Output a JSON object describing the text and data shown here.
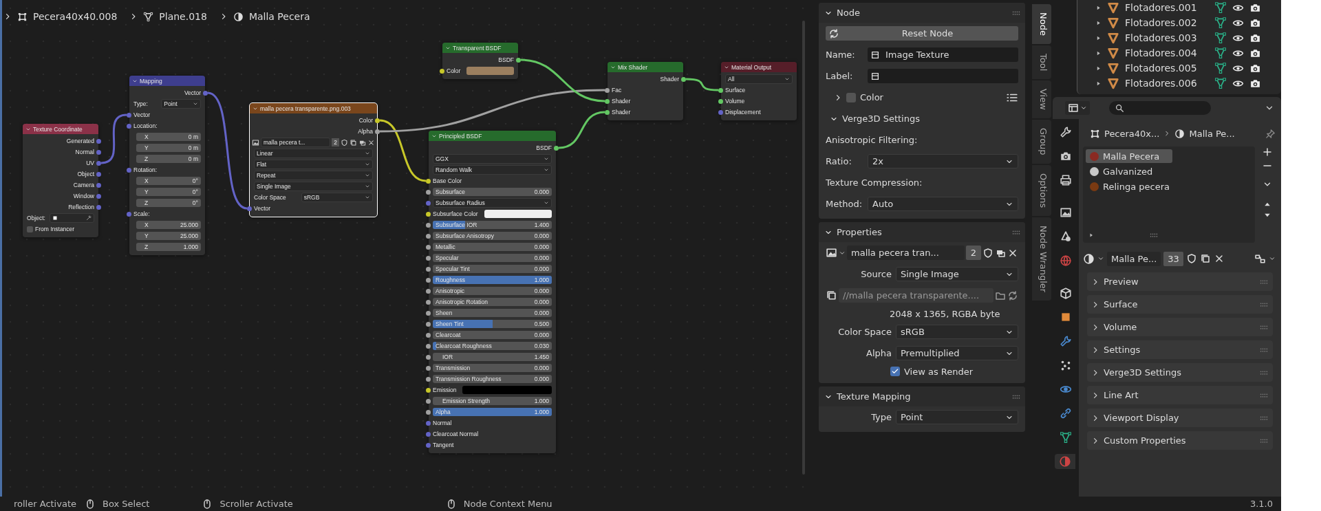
{
  "breadcrumb": [
    {
      "label": "Pecera40x40.008"
    },
    {
      "label": "Plane.018"
    },
    {
      "label": "Malla Pecera"
    }
  ],
  "nodes": [
    {
      "title": "Texture Coordinate",
      "kind": "input",
      "selected": false,
      "rows": [
        {
          "kind": "out",
          "label": "Generated",
          "color": "#6363c7"
        },
        {
          "kind": "out",
          "label": "Normal",
          "color": "#6363c7"
        },
        {
          "kind": "out",
          "label": "UV",
          "color": "#6363c7"
        },
        {
          "kind": "out",
          "label": "Object",
          "color": "#6363c7"
        },
        {
          "kind": "out",
          "label": "Camera",
          "color": "#6363c7"
        },
        {
          "kind": "out",
          "label": "Window",
          "color": "#6363c7"
        },
        {
          "kind": "out",
          "label": "Reflection",
          "color": "#6363c7"
        },
        {
          "kind": "object",
          "label": "Object:"
        },
        {
          "kind": "check",
          "label": "From Instancer",
          "checked": false
        }
      ]
    },
    {
      "title": "Mapping",
      "kind": "vector",
      "selected": false,
      "rows": [
        {
          "kind": "out",
          "label": "Vector",
          "color": "#6363c7"
        },
        {
          "kind": "dropdown",
          "label": "Type:",
          "value": "Point"
        },
        {
          "kind": "in",
          "label": "Vector",
          "color": "#6363c7"
        },
        {
          "kind": "heading",
          "label": "Location:",
          "color": "#6363c7"
        },
        {
          "kind": "axis",
          "label": "X",
          "value": "0 m"
        },
        {
          "kind": "axis",
          "label": "Y",
          "value": "0 m"
        },
        {
          "kind": "axis",
          "label": "Z",
          "value": "0 m"
        },
        {
          "kind": "heading",
          "label": "Rotation:",
          "color": "#6363c7"
        },
        {
          "kind": "axis",
          "label": "X",
          "value": "0°"
        },
        {
          "kind": "axis",
          "label": "Y",
          "value": "0°"
        },
        {
          "kind": "axis",
          "label": "Z",
          "value": "0°"
        },
        {
          "kind": "heading",
          "label": "Scale:",
          "color": "#6363c7"
        },
        {
          "kind": "axis",
          "label": "X",
          "value": "25.000"
        },
        {
          "kind": "axis",
          "label": "Y",
          "value": "25.000"
        },
        {
          "kind": "axis",
          "label": "Z",
          "value": "1.000"
        }
      ]
    },
    {
      "title": "malla pecera transparente.png.003",
      "kind": "texture",
      "selected": true,
      "rows": [
        {
          "kind": "out",
          "label": "Color",
          "color": "#c7c729"
        },
        {
          "kind": "out",
          "label": "Alpha",
          "color": "#a1a1a1"
        },
        {
          "kind": "image",
          "name": "malla pecera t...",
          "users": "2"
        },
        {
          "kind": "dropdown",
          "value": "Linear"
        },
        {
          "kind": "dropdown",
          "value": "Flat"
        },
        {
          "kind": "dropdown",
          "value": "Repeat"
        },
        {
          "kind": "dropdown",
          "value": "Single Image"
        },
        {
          "kind": "dropdown",
          "label": "Color Space",
          "value": "sRGB"
        },
        {
          "kind": "in",
          "label": "Vector",
          "color": "#6363c7"
        }
      ]
    },
    {
      "title": "Transparent BSDF",
      "kind": "shader",
      "selected": false,
      "rows": [
        {
          "kind": "out",
          "label": "BSDF",
          "color": "#63c763"
        },
        {
          "kind": "color",
          "label": "Color",
          "color": "#c7c729",
          "swatch": {
            "color": "#9b7f5f"
          }
        }
      ]
    },
    {
      "title": "Principled BSDF",
      "kind": "shader",
      "selected": false,
      "rows": [
        {
          "kind": "out",
          "label": "BSDF",
          "color": "#63c763"
        },
        {
          "kind": "dropdown",
          "value": "GGX"
        },
        {
          "kind": "dropdown",
          "value": "Random Walk"
        },
        {
          "kind": "in",
          "label": "Base Color",
          "color": "#c7c729"
        },
        {
          "kind": "slider",
          "label": "Subsurface",
          "value": "0.000",
          "level": 0,
          "color": "#a1a1a1"
        },
        {
          "kind": "dropdown",
          "value": "Subsurface Radius",
          "color": "#6363c7"
        },
        {
          "kind": "color",
          "label": "Subsurface Color",
          "color": "#c7c729",
          "swatch": {
            "color": "#f0f0f0"
          }
        },
        {
          "kind": "slider",
          "label": "Subsurface IOR",
          "value": "1.400",
          "level": 0.27,
          "color": "#a1a1a1"
        },
        {
          "kind": "slider",
          "label": "Subsurface Anisotropy",
          "value": "0.000",
          "level": 0,
          "color": "#a1a1a1"
        },
        {
          "kind": "slider",
          "label": "Metallic",
          "value": "0.000",
          "level": 0,
          "color": "#a1a1a1"
        },
        {
          "kind": "slider",
          "label": "Specular",
          "value": "0.000",
          "level": 0,
          "color": "#a1a1a1"
        },
        {
          "kind": "slider",
          "label": "Specular Tint",
          "value": "0.000",
          "level": 0,
          "color": "#a1a1a1"
        },
        {
          "kind": "slider",
          "label": "Roughness",
          "value": "1.000",
          "level": 1,
          "color": "#a1a1a1"
        },
        {
          "kind": "slider",
          "label": "Anisotropic",
          "value": "0.000",
          "level": 0,
          "color": "#a1a1a1"
        },
        {
          "kind": "slider",
          "label": "Anisotropic Rotation",
          "value": "0.000",
          "level": 0,
          "color": "#a1a1a1"
        },
        {
          "kind": "slider",
          "label": "Sheen",
          "value": "0.000",
          "level": 0,
          "color": "#a1a1a1"
        },
        {
          "kind": "slider",
          "label": "Sheen Tint",
          "value": "0.500",
          "level": 0.5,
          "color": "#a1a1a1"
        },
        {
          "kind": "slider",
          "label": "Clearcoat",
          "value": "0.000",
          "level": 0,
          "color": "#a1a1a1"
        },
        {
          "kind": "slider",
          "label": "Clearcoat Roughness",
          "value": "0.030",
          "level": 0.03,
          "color": "#a1a1a1"
        },
        {
          "kind": "number",
          "label": "IOR",
          "value": "1.450",
          "color": "#a1a1a1"
        },
        {
          "kind": "slider",
          "label": "Transmission",
          "value": "0.000",
          "level": 0,
          "color": "#a1a1a1"
        },
        {
          "kind": "slider",
          "label": "Transmission Roughness",
          "value": "0.000",
          "level": 0,
          "color": "#a1a1a1"
        },
        {
          "kind": "color",
          "label": "Emission",
          "color": "#c7c729",
          "swatch": {
            "color": "#000000"
          }
        },
        {
          "kind": "number",
          "label": "Emission Strength",
          "value": "1.000",
          "color": "#a1a1a1"
        },
        {
          "kind": "slider",
          "label": "Alpha",
          "value": "1.000",
          "level": 1,
          "color": "#a1a1a1"
        },
        {
          "kind": "in",
          "label": "Normal",
          "color": "#6363c7"
        },
        {
          "kind": "in",
          "label": "Clearcoat Normal",
          "color": "#6363c7"
        },
        {
          "kind": "in",
          "label": "Tangent",
          "color": "#6363c7"
        }
      ]
    },
    {
      "title": "Mix Shader",
      "kind": "shader",
      "selected": false,
      "rows": [
        {
          "kind": "out",
          "label": "Shader",
          "color": "#63c763"
        },
        {
          "kind": "in",
          "label": "Fac",
          "color": "#a1a1a1"
        },
        {
          "kind": "in",
          "label": "Shader",
          "color": "#63c763"
        },
        {
          "kind": "in",
          "label": "Shader",
          "color": "#63c763"
        }
      ]
    },
    {
      "title": "Material Output",
      "kind": "output",
      "selected": false,
      "rows": [
        {
          "kind": "dropdown",
          "value": "All"
        },
        {
          "kind": "in",
          "label": "Surface",
          "color": "#63c763"
        },
        {
          "kind": "in",
          "label": "Volume",
          "color": "#63c763"
        },
        {
          "kind": "in",
          "label": "Displacement",
          "color": "#6363c7"
        }
      ]
    }
  ],
  "sidebar": {
    "tabs": [
      {
        "label": "Node",
        "selected": true
      },
      {
        "label": "Tool",
        "selected": false
      },
      {
        "label": "View",
        "selected": false
      },
      {
        "label": "Group",
        "selected": false
      },
      {
        "label": "Options",
        "selected": false
      },
      {
        "label": "Node Wrangler",
        "selected": false
      }
    ],
    "panels": [
      {
        "title": "Node",
        "expanded": true,
        "rows": [
          {
            "kind": "button",
            "label": "Reset Node"
          },
          {
            "kind": "field",
            "label": "Name:",
            "value": "Image Texture"
          },
          {
            "kind": "field",
            "label": "Label:"
          },
          {
            "kind": "subpanel",
            "title": "Color",
            "expanded": false,
            "checked": false
          },
          {
            "kind": "subpanel",
            "title": "Verge3D Settings",
            "expanded": true
          },
          {
            "kind": "text",
            "label": "Anisotropic Filtering:"
          },
          {
            "kind": "dropdown",
            "label": "Ratio:",
            "value": "2x"
          },
          {
            "kind": "text",
            "label": "Texture Compression:"
          },
          {
            "kind": "dropdown",
            "label": "Method:",
            "value": "Auto"
          }
        ]
      },
      {
        "title": "Properties",
        "expanded": true,
        "rows": [
          {
            "kind": "image",
            "name": "malla pecera tran...",
            "users": "2"
          },
          {
            "kind": "dropdown",
            "label": "Source",
            "value": "Single Image"
          },
          {
            "kind": "filepath",
            "value": "//malla pecera transparente...."
          },
          {
            "kind": "info",
            "label": "2048 x 1365,  RGBA byte"
          },
          {
            "kind": "dropdown",
            "label": "Color Space",
            "value": "sRGB"
          },
          {
            "kind": "dropdown",
            "label": "Alpha",
            "value": "Premultiplied"
          },
          {
            "kind": "checkbox",
            "label": "View as Render",
            "checked": true
          }
        ]
      },
      {
        "title": "Texture Mapping",
        "expanded": true,
        "rows": [
          {
            "kind": "dropdown",
            "label": "Type",
            "value": "Point"
          }
        ]
      }
    ]
  },
  "outliner": {
    "rows": [
      {
        "name": "Flotadores.001",
        "expanded": false
      },
      {
        "name": "Flotadores.002",
        "expanded": false
      },
      {
        "name": "Flotadores.003",
        "expanded": false
      },
      {
        "name": "Flotadores.004",
        "expanded": false
      },
      {
        "name": "Flotadores.005",
        "expanded": false
      },
      {
        "name": "Flotadores.006",
        "expanded": false
      }
    ]
  },
  "properties": {
    "tabs": [
      {
        "selected": false
      },
      {
        "selected": false
      },
      {
        "selected": false
      },
      {
        "selected": false
      },
      {
        "selected": false
      },
      {
        "selected": false
      },
      {
        "selected": false
      },
      {
        "selected": false
      },
      {
        "selected": false
      },
      {
        "selected": false
      },
      {
        "selected": false
      },
      {
        "selected": false
      },
      {
        "selected": false
      },
      {
        "selected": true
      }
    ],
    "breadcrumb": [
      {
        "label": "Pecera40x..."
      },
      {
        "label": "Malla Pe..."
      }
    ],
    "material_slots": [
      {
        "name": "Malla Pecera",
        "selected": true,
        "color": "#8a2a22"
      },
      {
        "name": "Galvanized",
        "selected": false,
        "color": "#c8c8c8"
      },
      {
        "name": "Relinga pecera",
        "selected": false,
        "color": "#7a3a12"
      }
    ],
    "material": {
      "name": "Malla Pe...",
      "users": "33"
    },
    "panels": [
      {
        "title": "Preview",
        "expanded": false
      },
      {
        "title": "Surface",
        "expanded": false
      },
      {
        "title": "Volume",
        "expanded": false
      },
      {
        "title": "Settings",
        "expanded": false
      },
      {
        "title": "Verge3D Settings",
        "expanded": false
      },
      {
        "title": "Line Art",
        "expanded": false
      },
      {
        "title": "Viewport Display",
        "expanded": false
      },
      {
        "title": "Custom Properties",
        "expanded": false
      }
    ]
  },
  "status_bar": {
    "items": [
      {
        "kind": "text",
        "label": "roller Activate"
      },
      {
        "kind": "mouse",
        "label": "Box Select"
      },
      {
        "kind": "mouse",
        "label": "Scroller Activate"
      },
      {
        "kind": "mouse",
        "label": "Node Context Menu"
      }
    ],
    "version": "3.1.0"
  }
}
